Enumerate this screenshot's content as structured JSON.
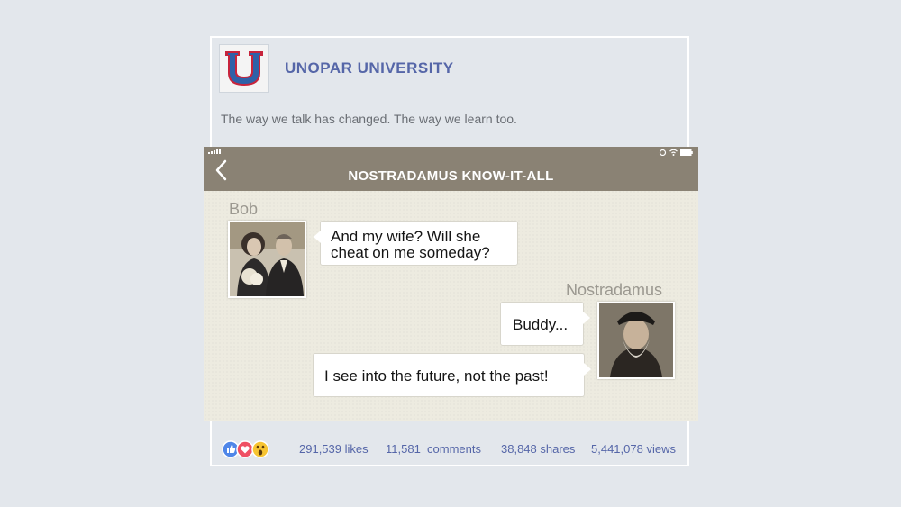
{
  "post": {
    "page_name": "UNOPAR UNIVERSITY",
    "caption": "The way we talk has changed. The way we learn too.",
    "logo_letter": "U",
    "colors": {
      "brand": "#5566a8",
      "logo_red": "#c8243c",
      "logo_blue": "#2f61a8"
    }
  },
  "chat": {
    "title": "NOSTRADAMUS KNOW-IT-ALL",
    "messages": [
      {
        "sender": "Bob",
        "lines": [
          "And my wife? Will she",
          "cheat on me someday?"
        ]
      },
      {
        "sender": "Nostradamus",
        "text": "Buddy..."
      },
      {
        "sender": "Nostradamus",
        "text": "I see into the future, not the past!"
      }
    ]
  },
  "engagement": {
    "reactions": [
      "like-icon",
      "love-icon",
      "wow-icon"
    ],
    "likes": "291,539 likes",
    "comments": "11,581  comments",
    "shares": "38,848 shares",
    "views": "5,441,078 views"
  }
}
